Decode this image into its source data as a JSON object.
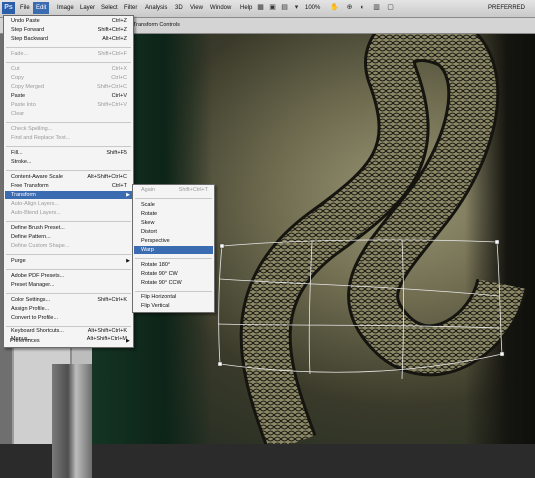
{
  "app": {
    "logo": "Ps"
  },
  "menubar": {
    "items": [
      "File",
      "Edit",
      "Image",
      "Layer",
      "Select",
      "Filter",
      "Analysis",
      "3D",
      "View",
      "Window",
      "Help"
    ],
    "zoom": "100%",
    "workspace": "PREFERRED"
  },
  "optionsbar": {
    "transform_controls": "Transform Controls"
  },
  "edit_menu": {
    "items": [
      {
        "label": "Undo Paste",
        "shortcut": "Ctrl+Z",
        "enabled": true
      },
      {
        "label": "Step Forward",
        "shortcut": "Shift+Ctrl+Z",
        "enabled": true
      },
      {
        "label": "Step Backward",
        "shortcut": "Alt+Ctrl+Z",
        "enabled": true
      },
      {
        "label": "Fade...",
        "shortcut": "Shift+Ctrl+F",
        "enabled": false
      },
      {
        "label": "Cut",
        "shortcut": "Ctrl+X",
        "enabled": false
      },
      {
        "label": "Copy",
        "shortcut": "Ctrl+C",
        "enabled": false
      },
      {
        "label": "Copy Merged",
        "shortcut": "Shift+Ctrl+C",
        "enabled": false
      },
      {
        "label": "Paste",
        "shortcut": "Ctrl+V",
        "enabled": true
      },
      {
        "label": "Paste Into",
        "shortcut": "Shift+Ctrl+V",
        "enabled": false
      },
      {
        "label": "Clear",
        "shortcut": "",
        "enabled": false
      },
      {
        "label": "Check Spelling...",
        "shortcut": "",
        "enabled": false
      },
      {
        "label": "Find and Replace Text...",
        "shortcut": "",
        "enabled": false
      },
      {
        "label": "Fill...",
        "shortcut": "Shift+F5",
        "enabled": true
      },
      {
        "label": "Stroke...",
        "shortcut": "",
        "enabled": true
      },
      {
        "label": "Content-Aware Scale",
        "shortcut": "Alt+Shift+Ctrl+C",
        "enabled": true
      },
      {
        "label": "Free Transform",
        "shortcut": "Ctrl+T",
        "enabled": true
      },
      {
        "label": "Transform",
        "shortcut": "",
        "enabled": true
      },
      {
        "label": "Auto-Align Layers...",
        "shortcut": "",
        "enabled": false
      },
      {
        "label": "Auto-Blend Layers...",
        "shortcut": "",
        "enabled": false
      },
      {
        "label": "Define Brush Preset...",
        "shortcut": "",
        "enabled": true
      },
      {
        "label": "Define Pattern...",
        "shortcut": "",
        "enabled": true
      },
      {
        "label": "Define Custom Shape...",
        "shortcut": "",
        "enabled": false
      },
      {
        "label": "Purge",
        "shortcut": "",
        "enabled": true
      },
      {
        "label": "Adobe PDF Presets...",
        "shortcut": "",
        "enabled": true
      },
      {
        "label": "Preset Manager...",
        "shortcut": "",
        "enabled": true
      },
      {
        "label": "Color Settings...",
        "shortcut": "Shift+Ctrl+K",
        "enabled": true
      },
      {
        "label": "Assign Profile...",
        "shortcut": "",
        "enabled": true
      },
      {
        "label": "Convert to Profile...",
        "shortcut": "",
        "enabled": true
      },
      {
        "label": "Keyboard Shortcuts...",
        "shortcut": "Alt+Shift+Ctrl+K",
        "enabled": true
      },
      {
        "label": "Menus...",
        "shortcut": "Alt+Shift+Ctrl+M",
        "enabled": true
      },
      {
        "label": "Preferences",
        "shortcut": "",
        "enabled": true
      }
    ]
  },
  "transform_submenu": {
    "items": [
      {
        "label": "Again",
        "shortcut": "Shift+Ctrl+T",
        "enabled": false
      },
      {
        "label": "Scale",
        "shortcut": "",
        "enabled": true
      },
      {
        "label": "Rotate",
        "shortcut": "",
        "enabled": true
      },
      {
        "label": "Skew",
        "shortcut": "",
        "enabled": true
      },
      {
        "label": "Distort",
        "shortcut": "",
        "enabled": true
      },
      {
        "label": "Perspective",
        "shortcut": "",
        "enabled": true
      },
      {
        "label": "Warp",
        "shortcut": "",
        "enabled": true
      },
      {
        "label": "Rotate 180°",
        "shortcut": "",
        "enabled": true
      },
      {
        "label": "Rotate 90° CW",
        "shortcut": "",
        "enabled": true
      },
      {
        "label": "Rotate 90° CCW",
        "shortcut": "",
        "enabled": true
      },
      {
        "label": "Flip Horizontal",
        "shortcut": "",
        "enabled": true
      },
      {
        "label": "Flip Vertical",
        "shortcut": "",
        "enabled": true
      }
    ]
  },
  "colors": {
    "highlight": "#3b6bb0",
    "menu_bg": "#f4f4f4",
    "disabled_text": "#9a9a9a"
  }
}
